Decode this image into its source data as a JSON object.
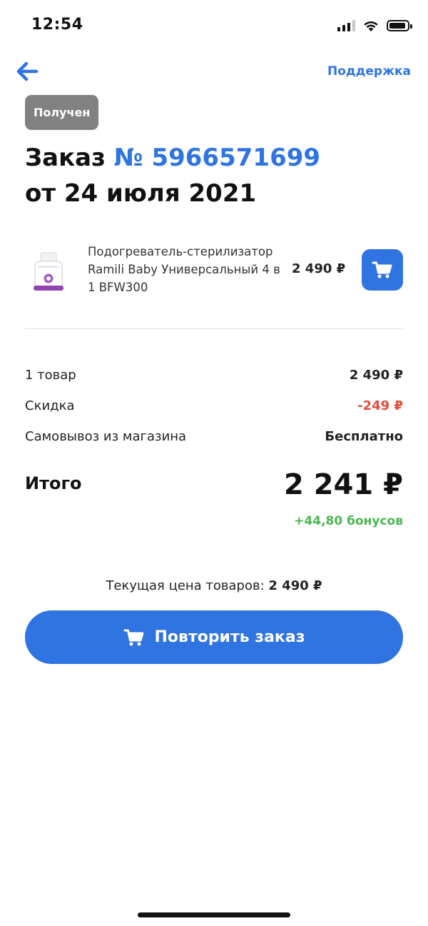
{
  "status_bar": {
    "time": "12:54"
  },
  "header": {
    "support_label": "Поддержка",
    "back_icon": "arrow-left-icon"
  },
  "order": {
    "status": "Получен",
    "title_prefix": "Заказ",
    "number": "№ 5966571699",
    "date_line": "от 24 июля 2021"
  },
  "product": {
    "name": "Подогреватель-стерилизатор Ramili Baby Универсальный 4 в 1 BFW300",
    "price": "2 490 ₽",
    "cart_icon": "cart-icon"
  },
  "summary": {
    "items_label": "1 товар",
    "items_value": "2 490 ₽",
    "discount_label": "Скидка",
    "discount_value": "-249 ₽",
    "delivery_label": "Самовывоз из магазина",
    "delivery_value": "Бесплатно",
    "total_label": "Итого",
    "total_value": "2 241 ₽",
    "bonus": "+44,80 бонусов"
  },
  "current_price": {
    "label": "Текущая цена товаров:",
    "value": "2 490 ₽"
  },
  "repeat_button": {
    "label": "Повторить заказ"
  },
  "colors": {
    "accent": "#2f74e0",
    "discount": "#e14b3b",
    "bonus": "#4cb750",
    "badge": "#818181"
  }
}
